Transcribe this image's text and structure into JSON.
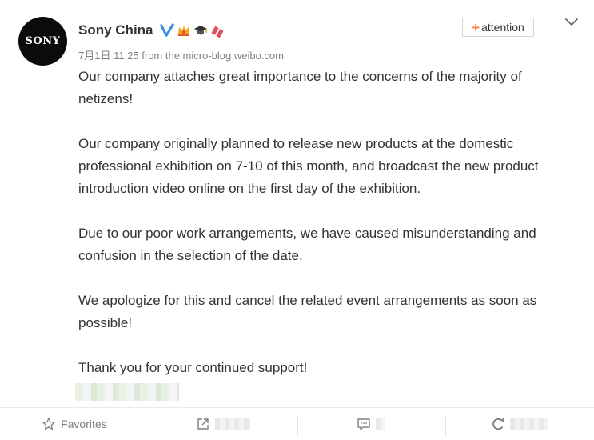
{
  "post": {
    "author": {
      "name": "Sony China",
      "avatar_text": "SONY",
      "badges": [
        "verified-v-icon",
        "crown-badge-icon",
        "graduation-cap-badge-icon",
        "gift-badge-icon"
      ]
    },
    "meta": "7月1日 11:25 from the micro-blog weibo.com",
    "follow_button": {
      "plus": "+",
      "label": "attention"
    },
    "paragraphs": [
      "Our company attaches great importance to the concerns of the majority of netizens!",
      "Our company originally planned to release new products at the domestic professional exhibition on 7-10 of this month, and broadcast the new product introduction video online on the first day of the exhibition.",
      "Due to our poor work arrangements, we have caused misunderstanding and confusion in the selection of the date.",
      "We apologize for this and cancel the related event arrangements as soon as possible!",
      "Thank you for your continued support!"
    ],
    "actions": {
      "favorites_label": "Favorites",
      "share_icon": "share-icon",
      "comment_icon": "comment-icon",
      "like_icon": "like-icon"
    }
  },
  "colors": {
    "verified": "#3b8ee8",
    "follow_plus": "#ff8140",
    "text": "#333333",
    "meta": "#808080"
  }
}
